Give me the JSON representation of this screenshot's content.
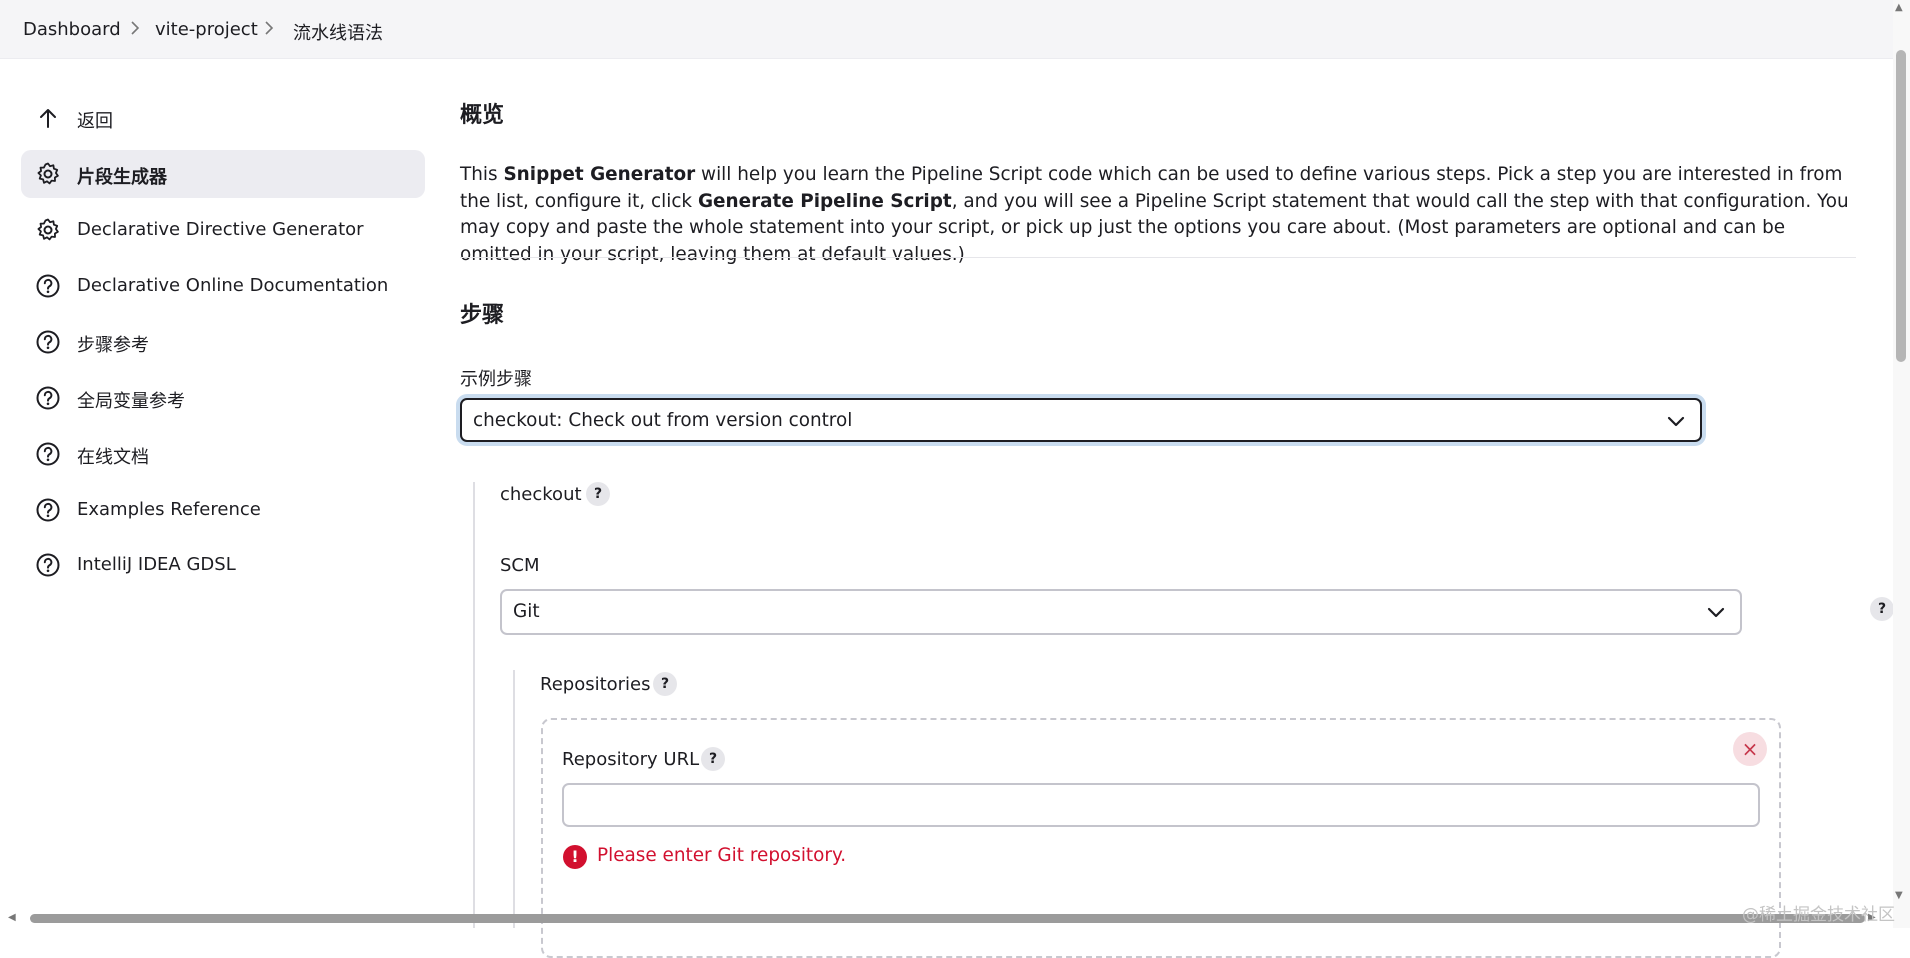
{
  "breadcrumb": {
    "items": [
      "Dashboard",
      "vite-project",
      "流水线语法"
    ]
  },
  "sidebar": {
    "items": [
      {
        "label": "返回",
        "icon": "arrow-up-icon"
      },
      {
        "label": "片段生成器",
        "icon": "gear-icon",
        "active": true
      },
      {
        "label": "Declarative Directive Generator",
        "icon": "gear-icon"
      },
      {
        "label": "Declarative Online Documentation",
        "icon": "help-circle-icon"
      },
      {
        "label": "步骤参考",
        "icon": "help-circle-icon"
      },
      {
        "label": "全局变量参考",
        "icon": "help-circle-icon"
      },
      {
        "label": "在线文档",
        "icon": "help-circle-icon"
      },
      {
        "label": "Examples Reference",
        "icon": "help-circle-icon"
      },
      {
        "label": "IntelliJ IDEA GDSL",
        "icon": "help-circle-icon"
      }
    ]
  },
  "main": {
    "overview_heading": "概览",
    "intro": {
      "p1": "This ",
      "b1": "Snippet Generator",
      "p2": " will help you learn the Pipeline Script code which can be used to define various steps. Pick a step you are interested in from the list, configure it, click ",
      "b2": "Generate Pipeline Script",
      "p3": ", and you will see a Pipeline Script statement that would call the step with that configuration. You may copy and paste the whole statement into your script, or pick up just the options you care about. (Most parameters are optional and can be omitted in your script, leaving them at default values.)"
    },
    "steps_heading": "步骤",
    "sample_step_label": "示例步骤",
    "sample_step_value": "checkout: Check out from version control",
    "checkout_label": "checkout",
    "help_symbol": "?",
    "scm_label": "SCM",
    "scm_value": "Git",
    "repositories_label": "Repositories",
    "repo_url_label": "Repository URL",
    "repo_url_value": "",
    "close_symbol": "×",
    "error_symbol": "!",
    "error_text": "Please enter Git repository."
  },
  "watermark": "@稀土掘金技术社区",
  "colors": {
    "error": "#d2102f",
    "focus_ring": "#c9dcef",
    "active_item_bg": "#ececf1"
  }
}
